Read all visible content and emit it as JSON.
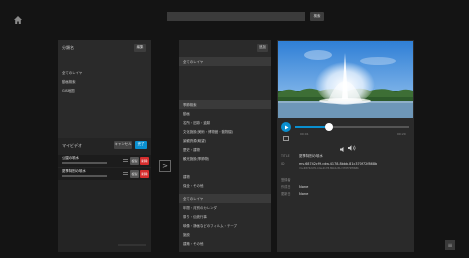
{
  "header": {
    "search_placeholder": "",
    "search_button": "検索"
  },
  "left_panel": {
    "title": "分類名",
    "title_button": "編集",
    "items": [
      {
        "label": "全てのレイヤ",
        "dim": false
      },
      {
        "label": "動画検索",
        "dim": false
      },
      {
        "label": "GIS地図",
        "dim": false
      },
      {
        "label": "",
        "dim": true
      },
      {
        "label": "",
        "dim": true
      },
      {
        "label": "",
        "dim": true
      }
    ]
  },
  "my_videos": {
    "title": "マイビデオ",
    "cancel_label": "キャンセル",
    "ok_label": "完了",
    "items": [
      {
        "title": "公園の噴水",
        "sub": "",
        "dup": "複製",
        "del": "削除"
      },
      {
        "title": "夏季特別の噴水",
        "sub": "",
        "dup": "複製",
        "del": "削除"
      }
    ],
    "footer": ""
  },
  "middle_panel": {
    "button": "追加",
    "items": [
      {
        "label": "全てのレイヤ",
        "selected": true
      },
      {
        "label": "",
        "selected": false
      },
      {
        "label": "",
        "selected": false
      },
      {
        "label": "",
        "selected": false
      },
      {
        "label": "季節検索",
        "selected": true
      },
      {
        "label": "動画",
        "selected": false
      },
      {
        "label": "名所・旧跡・遺跡",
        "selected": false
      },
      {
        "label": "文化施設(美術・博物館・動物園)",
        "selected": false
      },
      {
        "label": "景観資源(眺望)",
        "selected": false
      },
      {
        "label": "歴史・建物",
        "selected": false
      },
      {
        "label": "観光施設(季節物)",
        "selected": false
      },
      {
        "label": "",
        "selected": false
      },
      {
        "label": "建物",
        "selected": false
      },
      {
        "label": "保全・その他",
        "selected": false
      },
      {
        "label": "全てのレイヤ",
        "selected": true
      },
      {
        "label": "年間・月別のカレンダ",
        "selected": false
      },
      {
        "label": "祭り・伝統行事",
        "selected": false
      },
      {
        "label": "映像・静画などのフィルム・テープ",
        "selected": false
      },
      {
        "label": "施設",
        "selected": false
      },
      {
        "label": "建築・その他",
        "selected": false
      }
    ]
  },
  "arrow_label": ">",
  "detail": {
    "time_current": "00:01",
    "time_total": "00:20",
    "progress_fraction": 0.3,
    "fields": [
      {
        "key": "TITLE",
        "value": "夏季特別の噴水"
      },
      {
        "key": "ID",
        "value": "mv.68742cf9.cdw.4178.8bbb.81c370f72f868b"
      },
      {
        "key": "",
        "value": "mv.68742cf9.cdw.4178.8bbb.81c370f72f868b"
      },
      {
        "key": "登録者",
        "value": ""
      },
      {
        "key": "作成日",
        "value": "None"
      },
      {
        "key": "更新日",
        "value": "None"
      }
    ]
  },
  "corner_button": "≡",
  "colors": {
    "accent": "#0a8fcf",
    "delete": "#d62e2e",
    "panel": "#2a2a2a",
    "selected_row": "#3a3a3a"
  }
}
